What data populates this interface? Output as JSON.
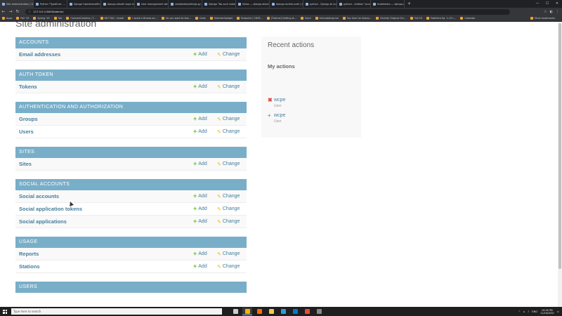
{
  "browser": {
    "tabs": [
      {
        "title": "Site administration | D"
      },
      {
        "title": "Python \"TypeError: ..."
      },
      {
        "title": "Django OperationalErr"
      },
      {
        "title": "django-allauth login er"
      },
      {
        "title": "User management with"
      },
      {
        "title": "radiostats/settings.py a"
      },
      {
        "title": "Django \"No such table\""
      },
      {
        "title": "Views — django-allauth"
      },
      {
        "title": "django.contrib.auth | D"
      },
      {
        "title": "python - Django all auth"
      },
      {
        "title": "python - relation \"accou"
      },
      {
        "title": "Installation — django-a"
      }
    ],
    "new_tab": "+",
    "window_controls": [
      "—",
      "☐",
      "✕"
    ],
    "url": "127.0.0.1:8000/admin/",
    "bookmarks": [
      {
        "label": "Apps"
      },
      {
        "label": "Fall '19"
      },
      {
        "label": "Spring '19"
      },
      {
        "label": "Tab"
      },
      {
        "label": "ConnectCarolina | T..."
      },
      {
        "label": "INIT FAQ - howdl"
      },
      {
        "label": "I wrote a fitness an..."
      },
      {
        "label": "So you want to lear..."
      },
      {
        "label": "Code"
      },
      {
        "label": "SelectorGadget"
      },
      {
        "label": "Endpoint | CRCR..."
      },
      {
        "label": "[Tutorial] Getting st..."
      },
      {
        "label": "Gach"
      },
      {
        "label": "klmcalebcay.me"
      },
      {
        "label": "Top User for Adven..."
      },
      {
        "label": "Divinity Original Sin..."
      },
      {
        "label": "Fall 20"
      },
      {
        "label": "FateZero Ep. 1-13 L..."
      },
      {
        "label": "Calendar"
      }
    ],
    "other_bookmarks": "Other bookmarks"
  },
  "admin": {
    "page_title": "Site administration",
    "add_label": "Add",
    "change_label": "Change",
    "modules": [
      {
        "caption": "Accounts",
        "models": [
          {
            "name": "Email addresses"
          }
        ]
      },
      {
        "caption": "Auth Token",
        "models": [
          {
            "name": "Tokens"
          }
        ]
      },
      {
        "caption": "Authentication and Authorization",
        "models": [
          {
            "name": "Groups"
          },
          {
            "name": "Users"
          }
        ]
      },
      {
        "caption": "Sites",
        "models": [
          {
            "name": "Sites"
          }
        ]
      },
      {
        "caption": "Social Accounts",
        "models": [
          {
            "name": "Social accounts"
          },
          {
            "name": "Social application tokens"
          },
          {
            "name": "Social applications"
          }
        ]
      },
      {
        "caption": "Usage",
        "models": [
          {
            "name": "Reports"
          },
          {
            "name": "Stations"
          }
        ]
      },
      {
        "caption": "Users",
        "models": []
      }
    ],
    "recent_actions": {
      "title": "Recent actions",
      "my_actions_title": "My actions",
      "items": [
        {
          "name": "wcpe",
          "type": "User",
          "kind": "deletion"
        },
        {
          "name": "wcpe",
          "type": "User",
          "kind": "addition"
        }
      ]
    }
  },
  "taskbar": {
    "search_placeholder": "Type here to search",
    "apps": [
      {
        "name": "task-view",
        "color": "#cccccc"
      },
      {
        "name": "chrome",
        "color": "#f4b400"
      },
      {
        "name": "search-app",
        "color": "#ff6d00"
      },
      {
        "name": "file-explorer",
        "color": "#f2c94c"
      },
      {
        "name": "mail",
        "color": "#2d9cdb"
      },
      {
        "name": "vscode",
        "color": "#007acc"
      },
      {
        "name": "app-red",
        "color": "#e74c3c"
      },
      {
        "name": "terminal",
        "color": "#888888"
      }
    ],
    "tray_language": "ENG",
    "time": "10:26 PM",
    "date": "11/16/2020"
  }
}
